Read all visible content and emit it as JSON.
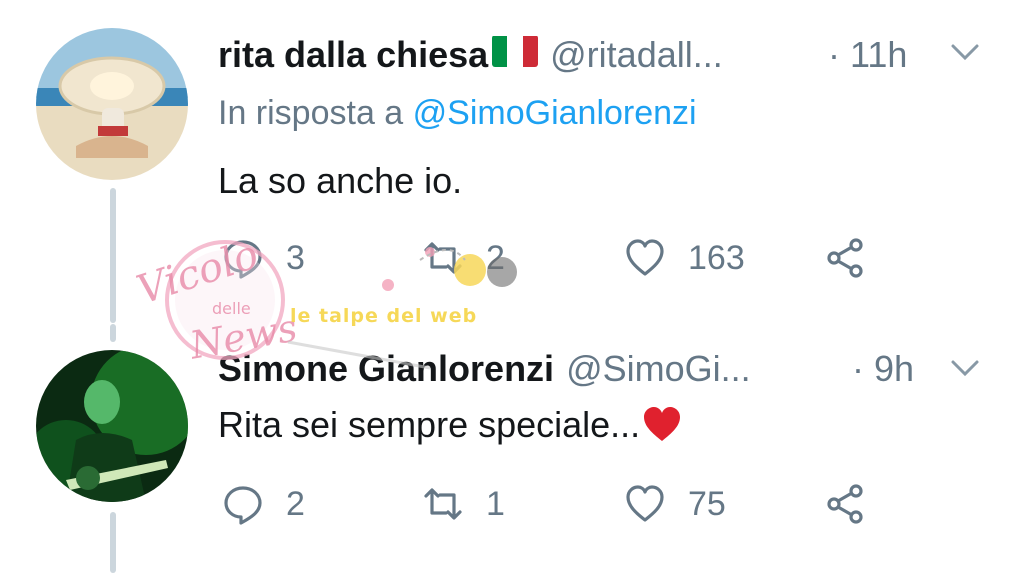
{
  "tweets": [
    {
      "name": "rita dalla chiesa",
      "flag_colors": [
        "#009246",
        "#ffffff",
        "#ce2b37"
      ],
      "handle": "@ritadall...",
      "time": "· 11h",
      "reply_prefix": "In risposta a ",
      "reply_mention": "@SimoGianlorenzi",
      "text": "La so anche io.",
      "stats": {
        "replies": "3",
        "retweets": "2",
        "likes": "163"
      }
    },
    {
      "name": "Simone Gianlorenzi",
      "handle": "@SimoGi...",
      "time": "· 9h",
      "text": "Rita sei sempre speciale...",
      "emoji": "red-heart",
      "stats": {
        "replies": "2",
        "retweets": "1",
        "likes": "75"
      }
    }
  ],
  "watermark": {
    "brand": "Vicolo delle News",
    "tagline": "le talpe del web"
  },
  "colors": {
    "text": "#14171a",
    "secondary": "#657786",
    "link": "#1da1f2",
    "thread": "#ccd6dd",
    "emoji_heart": "#e0212e"
  }
}
